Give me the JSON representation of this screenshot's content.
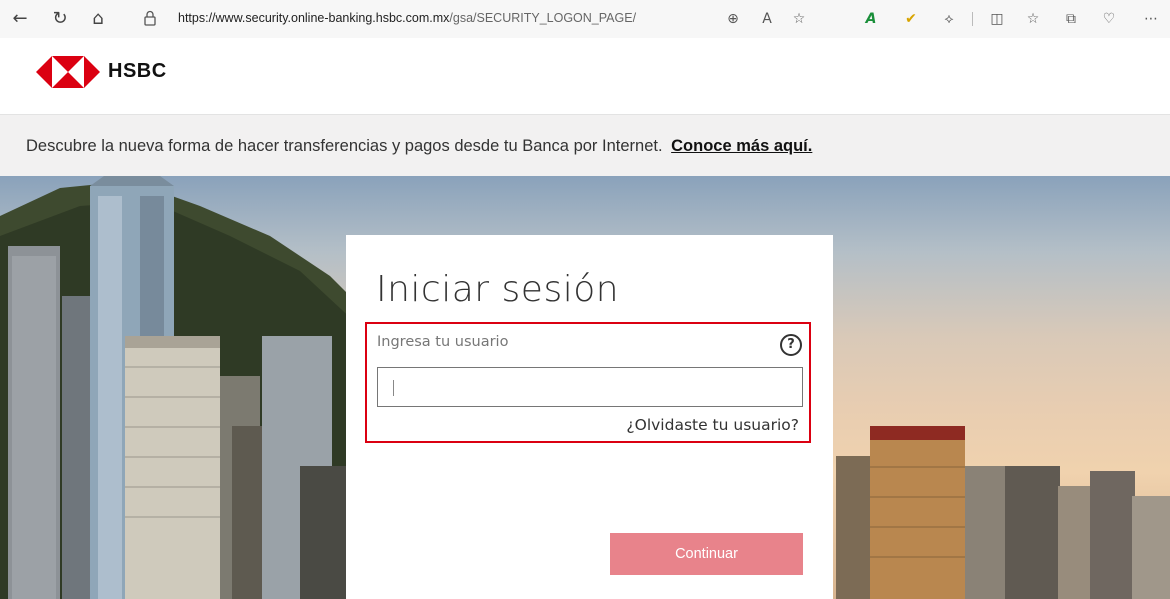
{
  "browser": {
    "url": "https://www.security.online-banking.hsbc.com.mx/gsa/SECURITY_LOGON_PAGE/",
    "url_host": "https://www.security.online-banking.hsbc.com.mx",
    "url_path": "/gsa/SECURITY_LOGON_PAGE/",
    "icons": [
      "back-icon",
      "refresh-icon",
      "home-icon",
      "lock-icon",
      "zoom-icon",
      "read-aloud-icon",
      "favorite-star-icon",
      "extension-a-icon",
      "extension-check-icon",
      "extension-puzzle-icon",
      "split-screen-icon",
      "favorites-list-icon",
      "collections-icon",
      "heart-pulse-icon",
      "more-icon"
    ]
  },
  "header": {
    "brand": "HSBC",
    "brand_colors": {
      "red": "#db0011",
      "white": "#ffffff"
    }
  },
  "banner": {
    "text": "Descubre la nueva forma de hacer transferencias y pagos desde tu Banca por Internet.",
    "link": "Conoce más aquí."
  },
  "login": {
    "title": "Iniciar sesión",
    "username_label": "Ingresa tu usuario",
    "username_value": "",
    "forgot_link": "¿Olvidaste tu usuario?",
    "continue_label": "Continuar",
    "help_glyph": "?"
  },
  "colors": {
    "accent_red": "#db0011",
    "continue_disabled": "#e8838b"
  }
}
